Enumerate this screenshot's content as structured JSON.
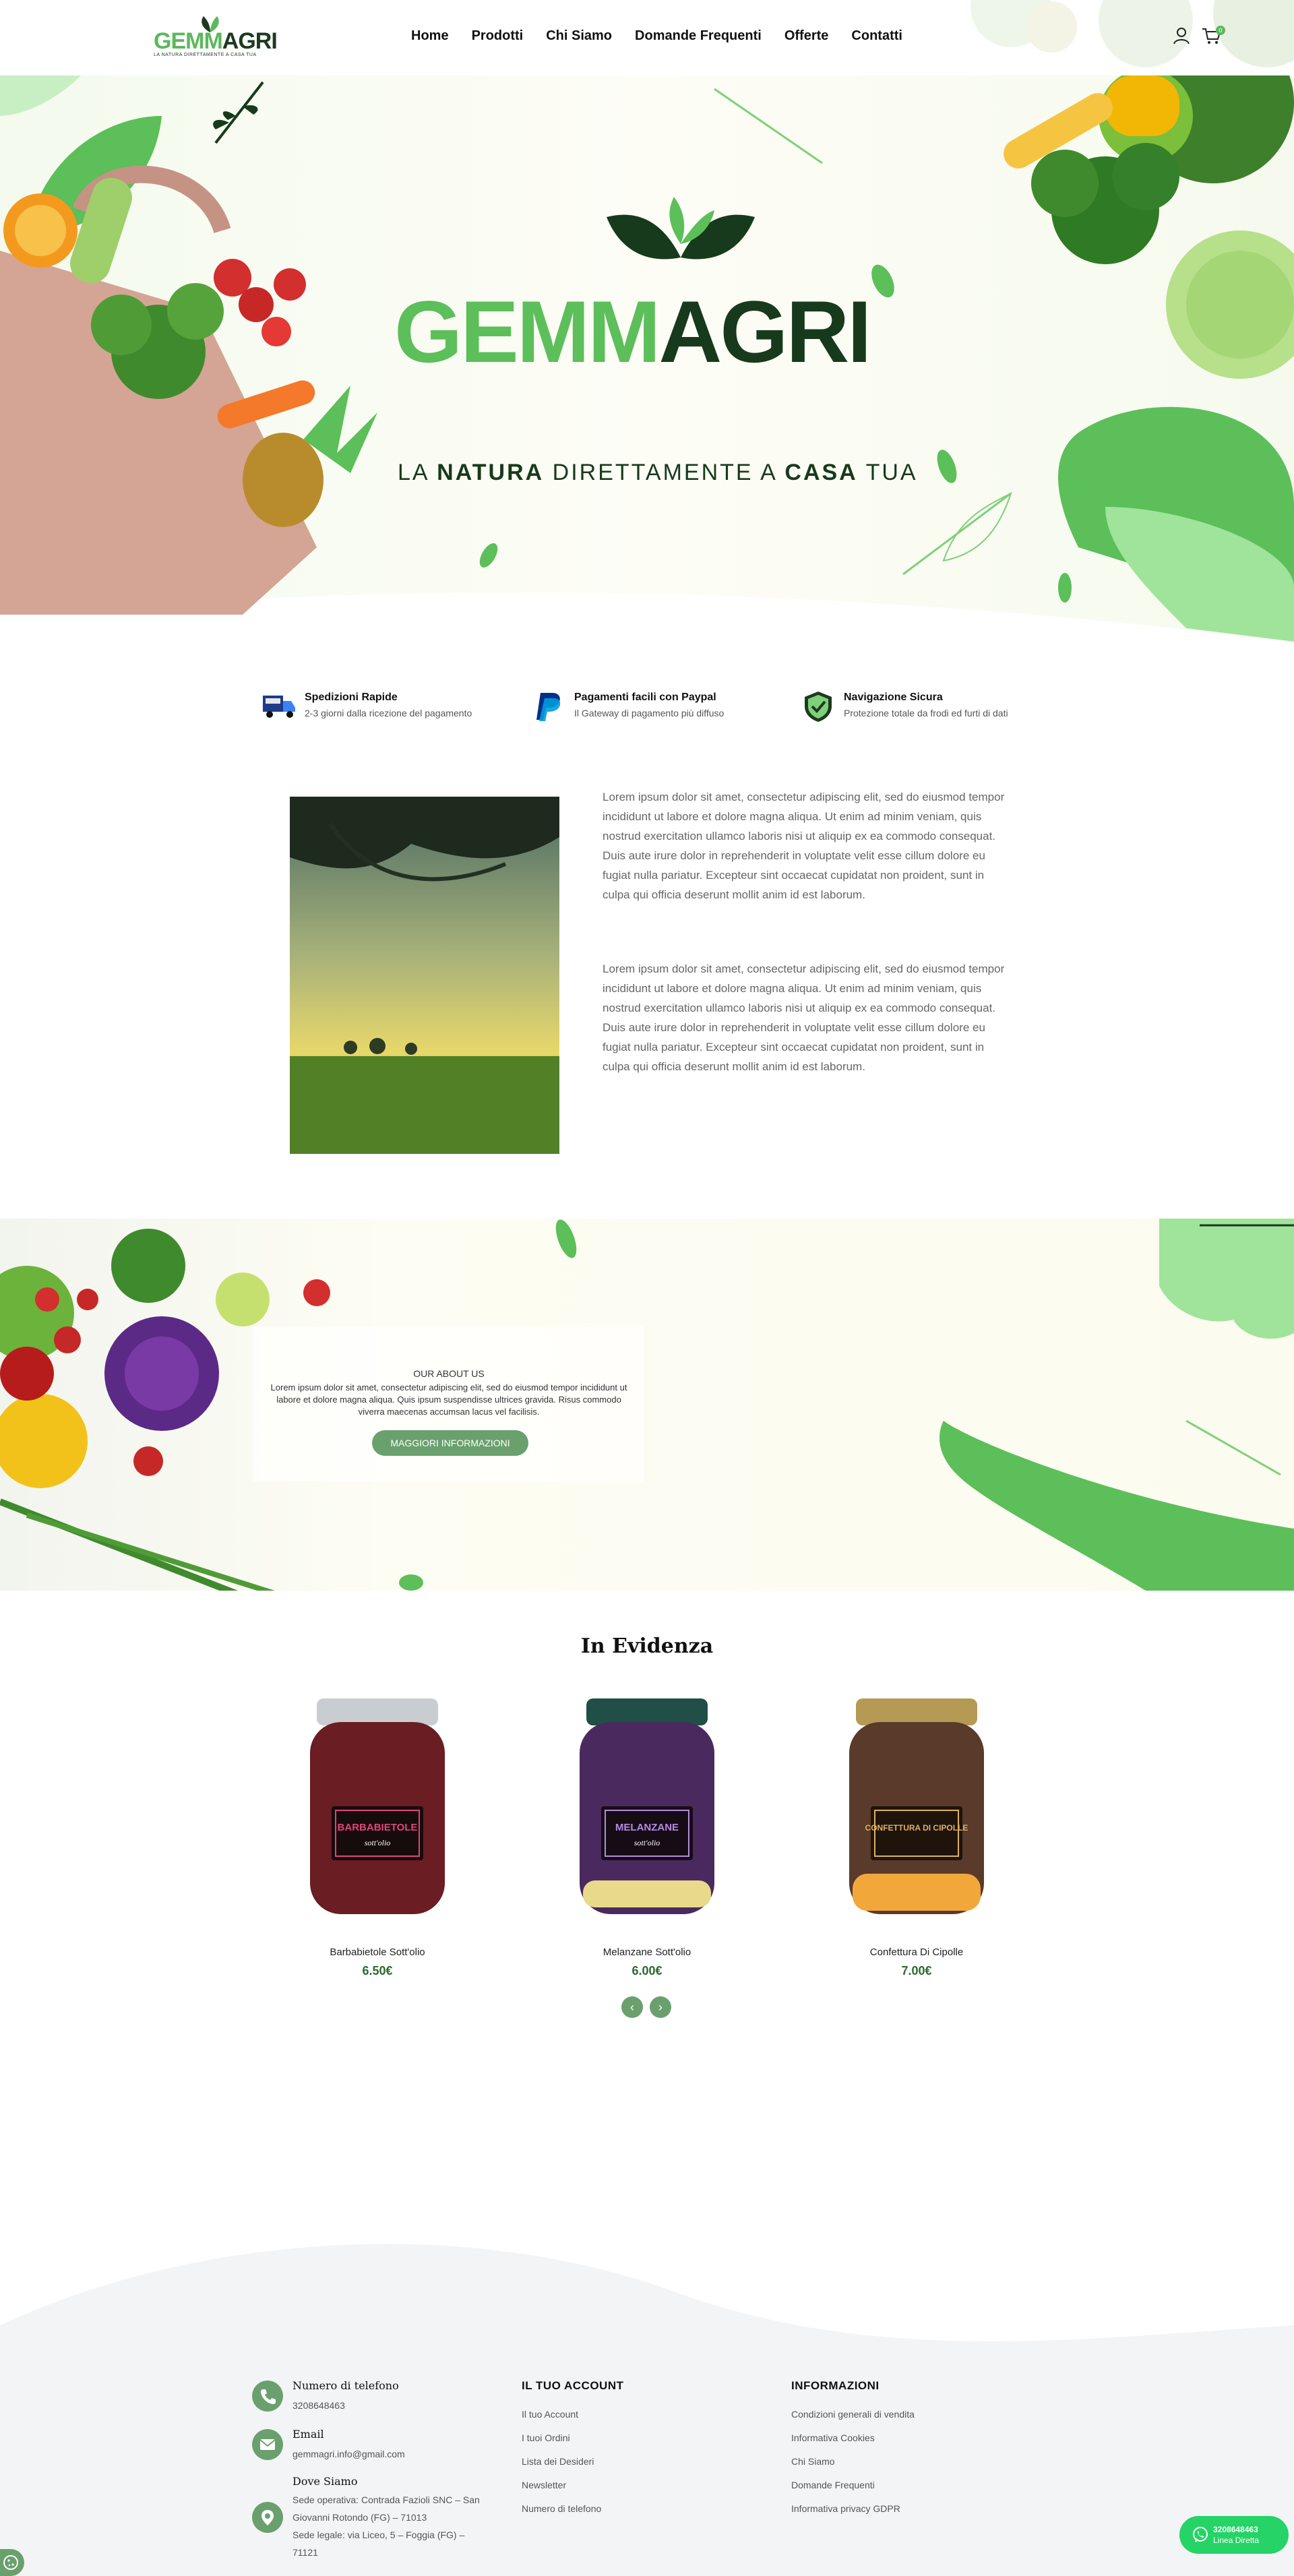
{
  "brand": {
    "logo_green": "GEMM",
    "logo_dark": "AGRI",
    "logo_tagline": "LA NATURA DIRETTAMENTE A CASA TUA",
    "tagline_part1": "LA",
    "tagline_bold1": "NATURA",
    "tagline_part2": "DIRETTAMENTE A",
    "tagline_bold2": "CASA",
    "tagline_part3": "TUA",
    "color_green": "#5cbf5a",
    "color_dark": "#173a1c"
  },
  "nav": {
    "items": [
      "Home",
      "Prodotti",
      "Chi Siamo",
      "Domande Frequenti",
      "Offerte",
      "Contatti"
    ],
    "cart_count": "0"
  },
  "features": [
    {
      "title": "Spedizioni Rapide",
      "subtitle": "2-3 giorni dalla ricezione del pagamento",
      "icon": "truck-icon"
    },
    {
      "title": "Pagamenti facili con Paypal",
      "subtitle": "Il Gateway di pagamento più diffuso",
      "icon": "paypal-icon"
    },
    {
      "title": "Navigazione Sicura",
      "subtitle": "Protezione totale da frodi ed furti di dati",
      "icon": "shield-icon"
    }
  ],
  "about": {
    "paragraph1": "Lorem ipsum dolor sit amet, consectetur adipiscing elit, sed do eiusmod tempor incididunt ut labore et dolore magna aliqua. Ut enim ad minim veniam, quis nostrud exercitation ullamco laboris nisi ut aliquip ex ea commodo consequat. Duis aute irure dolor in reprehenderit in voluptate velit esse cillum dolore eu fugiat nulla pariatur. Excepteur sint occaecat cupidatat non proident, sunt in culpa qui officia deserunt mollit anim id est laborum.",
    "paragraph2": "Lorem ipsum dolor sit amet, consectetur adipiscing elit, sed do eiusmod tempor incididunt ut labore et dolore magna aliqua. Ut enim ad minim veniam, quis nostrud exercitation ullamco laboris nisi ut aliquip ex ea commodo consequat. Duis aute irure dolor in reprehenderit in voluptate velit esse cillum dolore eu fugiat nulla pariatur. Excepteur sint occaecat cupidatat non proident, sunt in culpa qui officia deserunt mollit anim id est laborum."
  },
  "banner": {
    "kicker": "OUR ABOUT US",
    "text": "Lorem ipsum dolor sit amet, consectetur adipiscing elit, sed do eiusmod tempor incididunt ut labore et dolore magna aliqua. Quis ipsum suspendisse ultrices gravida. Risus commodo viverra maecenas accumsan lacus vel facilisis.",
    "button": "MAGGIORI INFORMAZIONI"
  },
  "featured": {
    "title": "In Evidenza",
    "products": [
      {
        "name": "Barbabietole Sott'olio",
        "price": "6.50€",
        "jar_label": "BARBABIETOLE",
        "jar_sub": "sott'olio",
        "lid_color": "#c9cdd2",
        "body_color": "#6a1d22",
        "label_color": "#e0447a"
      },
      {
        "name": "Melanzane Sott'olio",
        "price": "6.00€",
        "jar_label": "MELANZANE",
        "jar_sub": "sott'olio",
        "lid_color": "#1f4f47",
        "body_color": "#4a2a5e",
        "label_color": "#b58be0"
      },
      {
        "name": "Confettura Di Cipolle",
        "price": "7.00€",
        "jar_label": "CONFETTURA DI CIPOLLE",
        "jar_sub": "",
        "lid_color": "#b59a55",
        "body_color": "#5a3a2a",
        "label_color": "#e0b060"
      }
    ],
    "prev": "‹",
    "next": "›"
  },
  "footer": {
    "contacts": [
      {
        "label": "Numero di telefono",
        "lines": [
          "3208648463"
        ],
        "icon": "phone-icon"
      },
      {
        "label": "Email",
        "lines": [
          "gemmagri.info@gmail.com"
        ],
        "icon": "email-icon"
      },
      {
        "label": "Dove Siamo",
        "lines": [
          "Sede operativa: Contrada Fazioli SNC – San Giovanni Rotondo (FG) – 71013",
          "Sede legale: via Liceo, 5 – Foggia (FG) – 71121"
        ],
        "icon": "location-icon"
      }
    ],
    "account_title": "IL TUO ACCOUNT",
    "account_links": [
      "Il tuo Account",
      "I tuoi Ordini",
      "Lista dei Desideri",
      "Newsletter",
      "Numero di telefono"
    ],
    "info_title": "INFORMAZIONI",
    "info_links": [
      "Condizioni generali di vendita",
      "Informativa Cookies",
      "Chi Siamo",
      "Domande Frequenti",
      "Informativa privacy GDPR"
    ]
  },
  "whatsapp": {
    "number": "3208648463",
    "label": "Linea Diretta"
  }
}
